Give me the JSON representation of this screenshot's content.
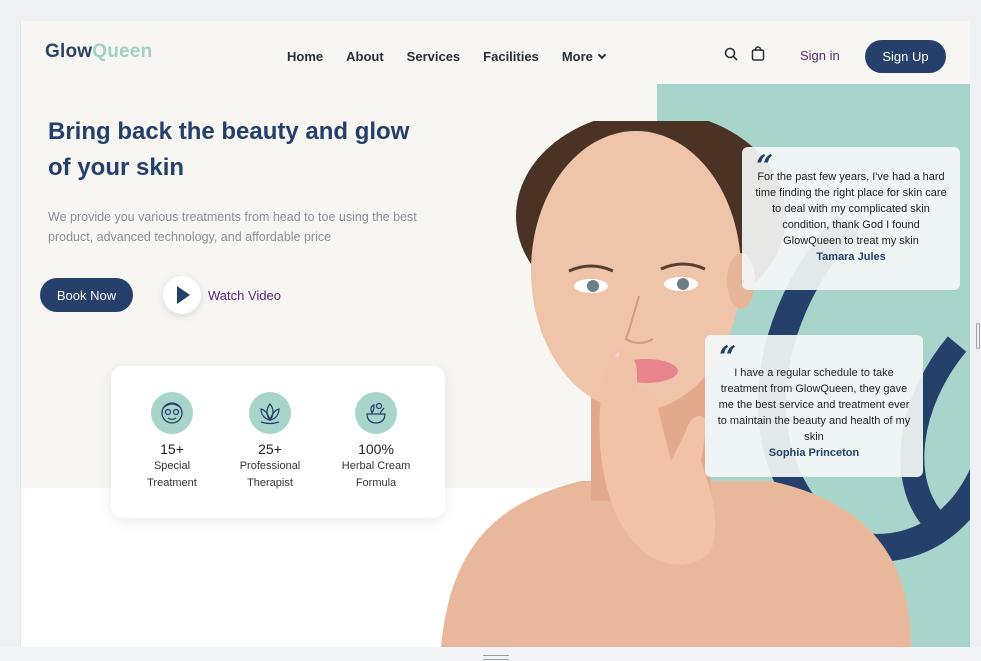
{
  "nav": {
    "logo_part1": "Glow",
    "logo_part2": "Queen",
    "links": [
      "Home",
      "About",
      "Services",
      "Facilities",
      "More"
    ],
    "signin_label": "Sign in",
    "signup_label": "Sign Up"
  },
  "hero": {
    "headline": "Bring back the beauty and glow of your skin",
    "subtext": "We provide you various treatments from head to toe using the best product, advanced technology, and affordable price",
    "book_label": "Book Now",
    "watch_label": "Watch Video"
  },
  "stats": [
    {
      "number": "15+",
      "label_line1": "Special",
      "label_line2": "Treatment",
      "icon": "face-mask-icon"
    },
    {
      "number": "25+",
      "label_line1": "Professional",
      "label_line2": "Therapist",
      "icon": "lotus-icon"
    },
    {
      "number": "100%",
      "label_line1": "Herbal Cream",
      "label_line2": "Formula",
      "icon": "herbal-bowl-icon"
    }
  ],
  "testimonials": [
    {
      "text": "For the past few years, I've had a hard time finding the right place for skin care to deal with my complicated skin condition, thank God I found GlowQueen to treat my skin",
      "name": "Tamara Jules"
    },
    {
      "text": "I have a regular schedule to take treatment from GlowQueen, they gave me the best service and treatment ever to maintain the beauty and health of my skin",
      "name": "Sophia Princeton"
    }
  ],
  "colors": {
    "navy": "#25406a",
    "teal": "#a8d5cb",
    "purple_link": "#4d2a7a",
    "cream_bg": "#f8f6f3"
  }
}
